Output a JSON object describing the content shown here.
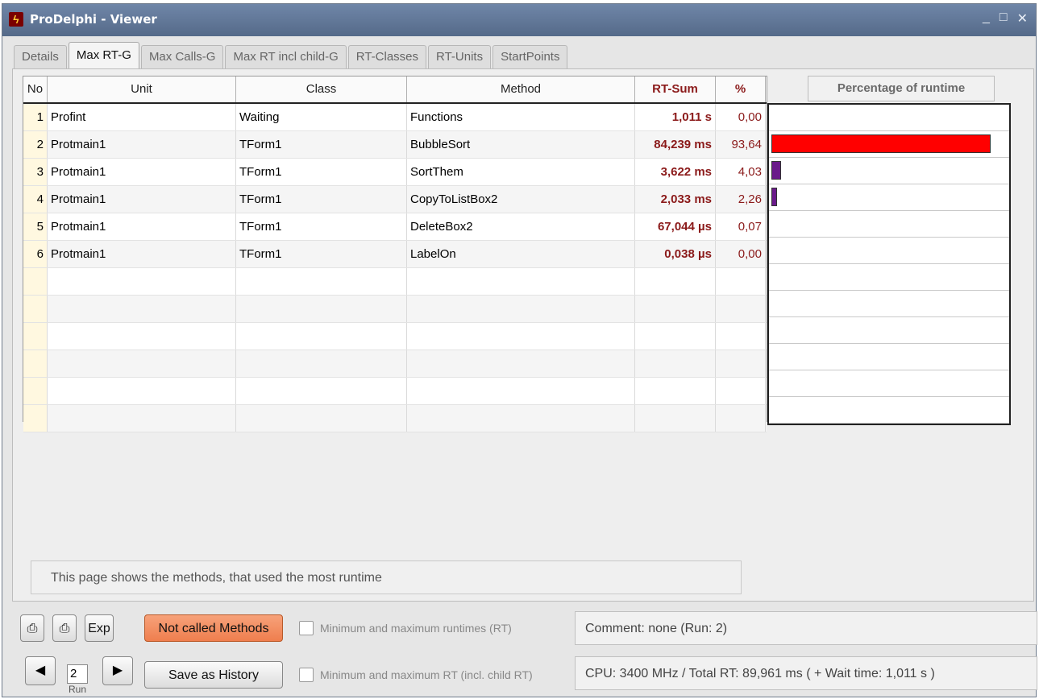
{
  "window": {
    "title": "ProDelphi - Viewer",
    "controls": [
      "_",
      "□",
      "✕"
    ]
  },
  "tabs": [
    {
      "label": "Details",
      "active": false
    },
    {
      "label": "Max RT-G",
      "active": true
    },
    {
      "label": "Max Calls-G",
      "active": false
    },
    {
      "label": "Max RT incl child-G",
      "active": false
    },
    {
      "label": "RT-Classes",
      "active": false
    },
    {
      "label": "RT-Units",
      "active": false
    },
    {
      "label": "StartPoints",
      "active": false
    }
  ],
  "table": {
    "headers": {
      "no": "No",
      "unit": "Unit",
      "class": "Class",
      "method": "Method",
      "rtsum": "RT-Sum",
      "pct": "%"
    },
    "rows": [
      {
        "no": "1",
        "unit": "Profint",
        "class": "Waiting",
        "method": "Functions",
        "rtsum": "1,011  s",
        "pct": "0,00"
      },
      {
        "no": "2",
        "unit": "Protmain1",
        "class": "TForm1",
        "method": "BubbleSort",
        "rtsum": "84,239 ms",
        "pct": "93,64"
      },
      {
        "no": "3",
        "unit": "Protmain1",
        "class": "TForm1",
        "method": "SortThem",
        "rtsum": "3,622 ms",
        "pct": "4,03"
      },
      {
        "no": "4",
        "unit": "Protmain1",
        "class": "TForm1",
        "method": "CopyToListBox2",
        "rtsum": "2,033 ms",
        "pct": "2,26"
      },
      {
        "no": "5",
        "unit": "Protmain1",
        "class": "TForm1",
        "method": "DeleteBox2",
        "rtsum": "67,044 µs",
        "pct": "0,07"
      },
      {
        "no": "6",
        "unit": "Protmain1",
        "class": "TForm1",
        "method": "LabelOn",
        "rtsum": "0,038 µs",
        "pct": "0,00"
      }
    ]
  },
  "chart": {
    "title": "Percentage of runtime",
    "bars": [
      {
        "value": 0.0,
        "color": "#ffffff"
      },
      {
        "value": 93.64,
        "color": "#ff0000"
      },
      {
        "value": 4.03,
        "color": "#6a1a8a"
      },
      {
        "value": 2.26,
        "color": "#6a1a8a"
      },
      {
        "value": 0.07,
        "color": "#ffffff"
      },
      {
        "value": 0.0,
        "color": "#ffffff"
      }
    ]
  },
  "status": {
    "text": "This page shows the methods, that used the most  runtime"
  },
  "bottom": {
    "print1_icon": "printer-icon",
    "print2_icon": "printer-preview-icon",
    "exp_label": "Exp",
    "not_called_label": "Not called Methods",
    "minmax_label": "Minimum and maximum runtimes (RT)",
    "minmax_child_label": "Minimum and maximum RT (incl. child RT)",
    "comment": "Comment: none (Run: 2)",
    "cpu": "CPU: 3400 MHz / Total RT: 89,961 ms  ( + Wait time: 1,011  s  )",
    "run_value": "2",
    "run_label": "Run",
    "prev_label": "◀",
    "next_label": "▶",
    "save_history_label": "Save as History"
  }
}
